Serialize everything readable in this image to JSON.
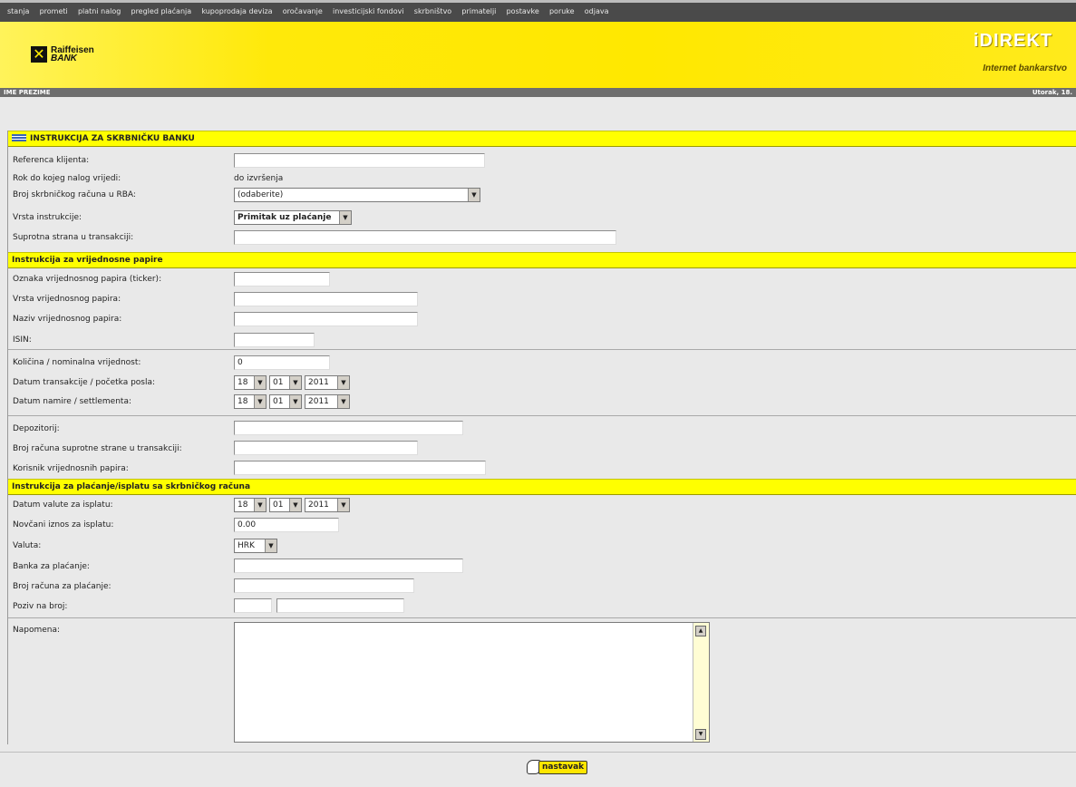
{
  "nav": [
    "stanja",
    "prometi",
    "platni nalog",
    "pregled plaćanja",
    "kupoprodaja deviza",
    "oročavanje",
    "investicijski fondovi",
    "skrbništvo",
    "primatelji",
    "postavke",
    "poruke",
    "odjava"
  ],
  "brand": {
    "bank_line1": "Raiffeisen",
    "bank_line2": "BANK",
    "product": "iDIREKT",
    "product_sub": "Internet bankarstvo"
  },
  "userbar": {
    "name": "IME PREZIME",
    "date": "Utorak, 18."
  },
  "sections": {
    "s1": "INSTRUKCIJA ZA SKRBNIČKU BANKU",
    "s2": "Instrukcija za vrijednosne papire",
    "s3": "Instrukcija za plaćanje/isplatu sa skrbničkog računa"
  },
  "labels": {
    "ref": "Referenca klijenta:",
    "rok": "Rok do kojeg nalog vrijedi:",
    "racun": "Broj skrbničkog računa u RBA:",
    "vrsta_instr": "Vrsta instrukcije:",
    "suprotna": "Suprotna strana u transakciji:",
    "oznaka": "Oznaka vrijednosnog papira (ticker):",
    "vrsta_papira": "Vrsta vrijednosnog papira:",
    "naziv": "Naziv vrijednosnog papira:",
    "isin": "ISIN:",
    "kolicina": "Količina / nominalna vrijednost:",
    "dat_trans": "Datum transakcije / početka posla:",
    "dat_namire": "Datum namire / settlementa:",
    "depozitorij": "Depozitorij:",
    "broj_supr": "Broj računa suprotne strane u transakciji:",
    "korisnik": "Korisnik vrijednosnih papira:",
    "dat_valute": "Datum valute za isplatu:",
    "iznos": "Novčani iznos za isplatu:",
    "valuta": "Valuta:",
    "banka": "Banka za plaćanje:",
    "broj_plac": "Broj računa za plaćanje:",
    "poziv": "Poziv na broj:",
    "napomena": "Napomena:"
  },
  "values": {
    "rok": "do izvršenja",
    "racun": "(odaberite)",
    "vrsta_instr": "Primitak uz plaćanje",
    "kolicina": "0",
    "iznos": "0.00",
    "valuta": "HRK",
    "day": "18",
    "month": "01",
    "year": "2011"
  },
  "button": "nastavak"
}
